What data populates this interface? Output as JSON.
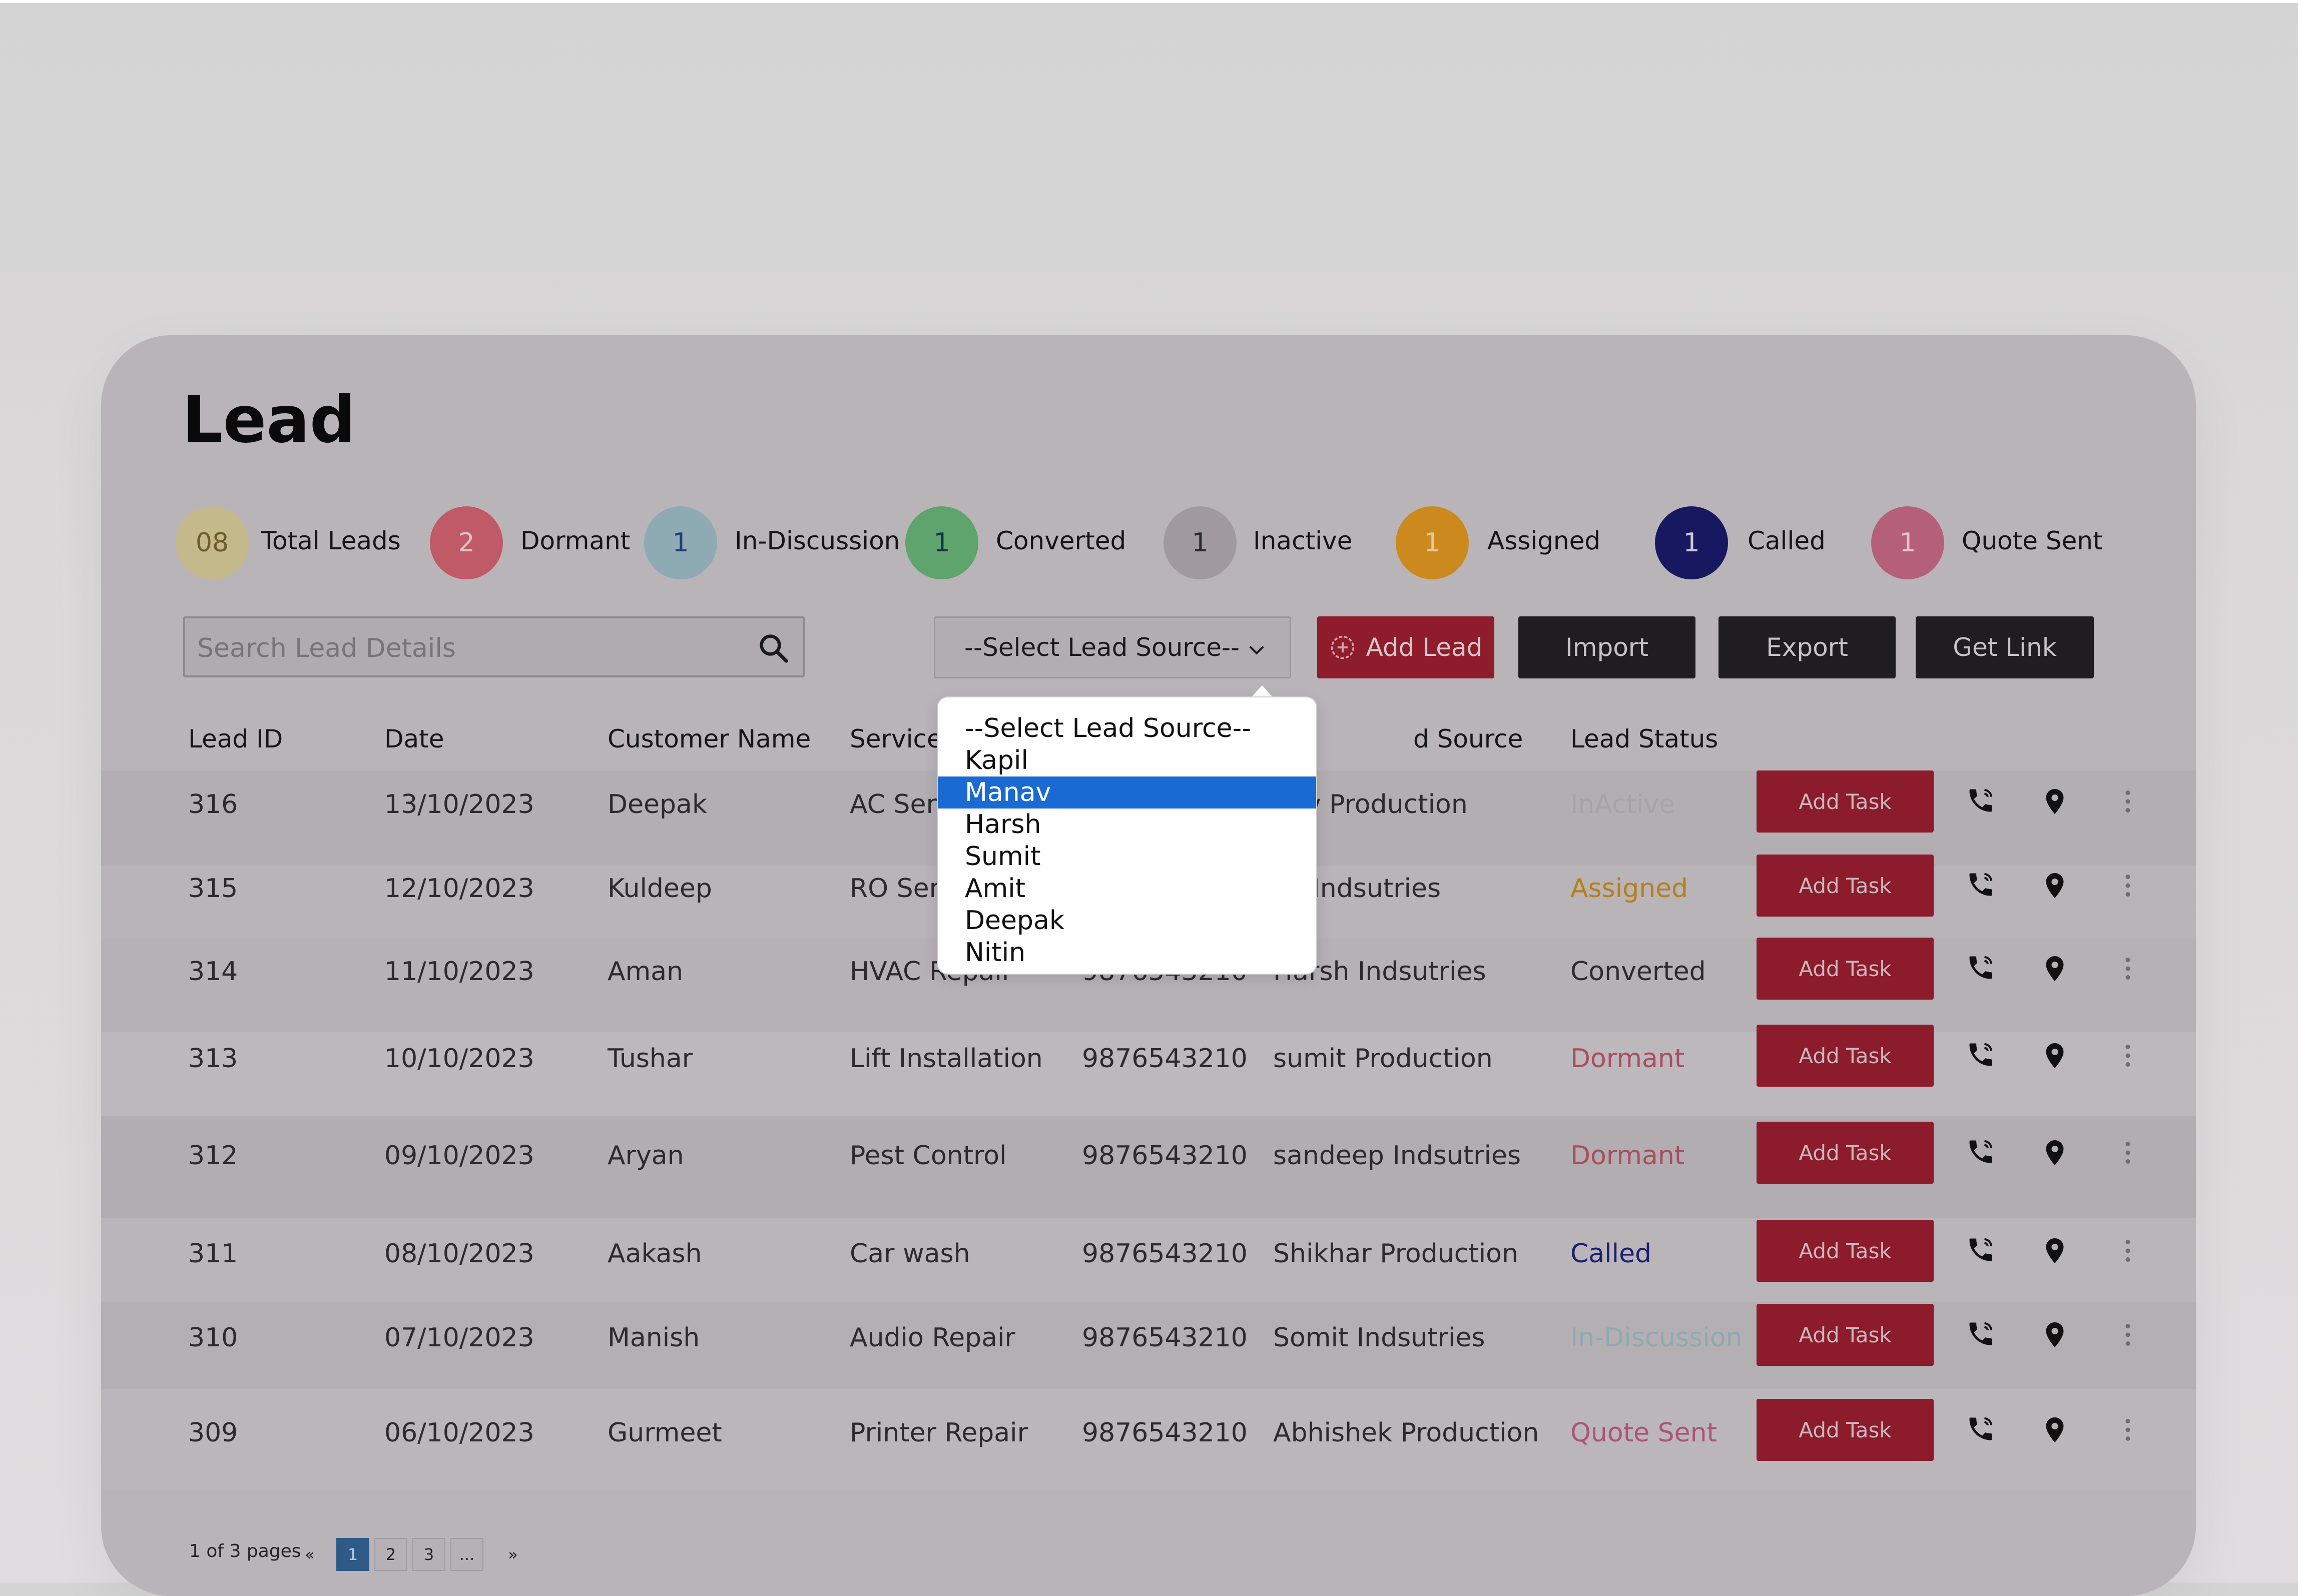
{
  "page": {
    "title": "Lead"
  },
  "stats": [
    {
      "count": "08",
      "label": "Total Leads",
      "color": "#c4b98a",
      "text_color": "#6b5c2a"
    },
    {
      "count": "2",
      "label": "Dormant",
      "color": "#c05a66",
      "text_color": "#d8c3c6"
    },
    {
      "count": "1",
      "label": "In-Discussion",
      "color": "#8eaab3",
      "text_color": "#1e3f78"
    },
    {
      "count": "1",
      "label": "Converted",
      "color": "#5fa36d",
      "text_color": "#17324d"
    },
    {
      "count": "1",
      "label": "Inactive",
      "color": "#a09a9e",
      "text_color": "#2a2a2a"
    },
    {
      "count": "1",
      "label": "Assigned",
      "color": "#cc8a1e",
      "text_color": "#e5c9a0"
    },
    {
      "count": "1",
      "label": "Called",
      "color": "#17185f",
      "text_color": "#c9cae0"
    },
    {
      "count": "1",
      "label": "Quote Sent",
      "color": "#b5607b",
      "text_color": "#e2c6cf"
    }
  ],
  "toolbar": {
    "search_placeholder": "Search Lead Details",
    "select_value": "--Select Lead Source--",
    "add_lead": "Add Lead",
    "import": "Import",
    "export": "Export",
    "get_link": "Get Link"
  },
  "table": {
    "headers": {
      "lead_id": "Lead ID",
      "date": "Date",
      "customer": "Customer Name",
      "service": "Service",
      "source": "d Source",
      "status": "Lead Status"
    },
    "action_label": "Add Task",
    "rows": [
      {
        "id": "316",
        "date": "13/10/2023",
        "customer": "Deepak",
        "service": "AC Serv",
        "phone": "",
        "source": "nav Production",
        "status": "InActive",
        "status_color": "#a8a3a7"
      },
      {
        "id": "315",
        "date": "12/10/2023",
        "customer": "Kuldeep",
        "service": "RO Serv",
        "phone": "",
        "source": "pil Indsutries",
        "status": "Assigned",
        "status_color": "#b57f18"
      },
      {
        "id": "314",
        "date": "11/10/2023",
        "customer": "Aman",
        "service": "HVAC Repair",
        "phone": "9876543210",
        "source": "Harsh Indsutries",
        "status": "Converted",
        "status_color": "#2c2a2d"
      },
      {
        "id": "313",
        "date": "10/10/2023",
        "customer": "Tushar",
        "service": "Lift Installation",
        "phone": "9876543210",
        "source": "sumit Production",
        "status": "Dormant",
        "status_color": "#a84e5e"
      },
      {
        "id": "312",
        "date": "09/10/2023",
        "customer": "Aryan",
        "service": "Pest Control",
        "phone": "9876543210",
        "source": "sandeep Indsutries",
        "status": "Dormant",
        "status_color": "#a84e5e"
      },
      {
        "id": "311",
        "date": "08/10/2023",
        "customer": "Aakash",
        "service": "Car wash",
        "phone": "9876543210",
        "source": "Shikhar Production",
        "status": "Called",
        "status_color": "#1b1f6e"
      },
      {
        "id": "310",
        "date": "07/10/2023",
        "customer": "Manish",
        "service": "Audio Repair",
        "phone": "9876543210",
        "source": "Somit Indsutries",
        "status": "In-Discussion",
        "status_color": "#8eaab0"
      },
      {
        "id": "309",
        "date": "06/10/2023",
        "customer": "Gurmeet",
        "service": "Printer Repair",
        "phone": "9876543210",
        "source": "Abhishek Production",
        "status": "Quote Sent",
        "status_color": "#ac5470"
      }
    ]
  },
  "pagination": {
    "summary": "1 of 3 pages",
    "prev": "«",
    "pages": [
      "1",
      "2",
      "3",
      "..."
    ],
    "next": "»",
    "current": "1"
  },
  "dropdown": {
    "options": [
      "--Select Lead Source--",
      "Kapil",
      "Manav",
      "Harsh",
      "Sumit",
      "Amit",
      "Deepak",
      "Nitin"
    ],
    "highlighted": "Manav"
  }
}
